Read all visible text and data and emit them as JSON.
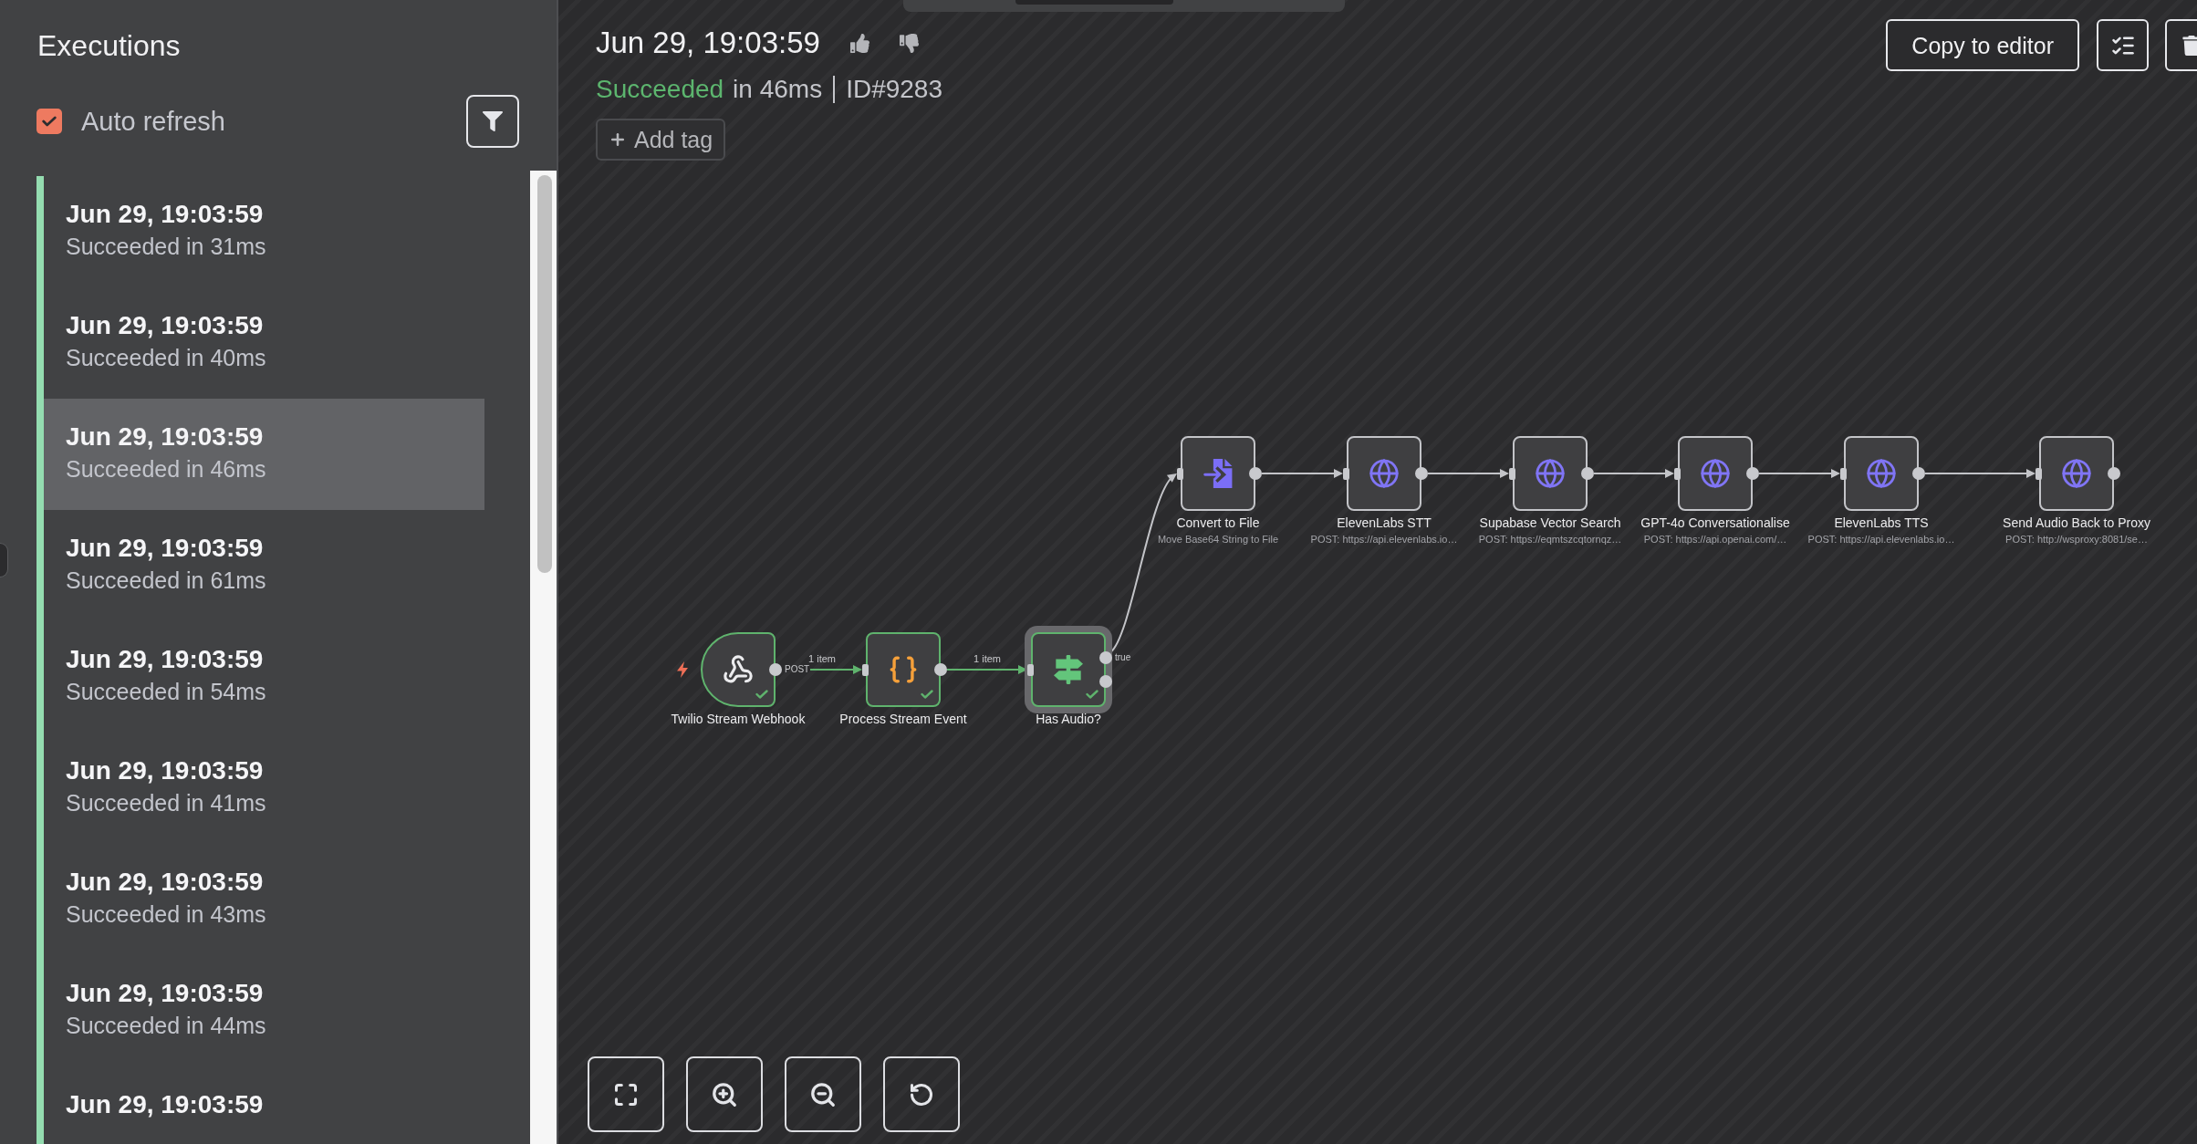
{
  "sidebar": {
    "title": "Executions",
    "auto_refresh": {
      "label": "Auto refresh",
      "checked": true
    },
    "executions": [
      {
        "time": "Jun 29, 19:03:59",
        "status": "Succeeded in 31ms",
        "kind": "success",
        "selected": false
      },
      {
        "time": "Jun 29, 19:03:59",
        "status": "Succeeded in 40ms",
        "kind": "success",
        "selected": false
      },
      {
        "time": "Jun 29, 19:03:59",
        "status": "Succeeded in 46ms",
        "kind": "success",
        "selected": true
      },
      {
        "time": "Jun 29, 19:03:59",
        "status": "Succeeded in 61ms",
        "kind": "success",
        "selected": false
      },
      {
        "time": "Jun 29, 19:03:59",
        "status": "Succeeded in 54ms",
        "kind": "success",
        "selected": false
      },
      {
        "time": "Jun 29, 19:03:59",
        "status": "Succeeded in 41ms",
        "kind": "success",
        "selected": false
      },
      {
        "time": "Jun 29, 19:03:59",
        "status": "Succeeded in 43ms",
        "kind": "success",
        "selected": false
      },
      {
        "time": "Jun 29, 19:03:59",
        "status": "Succeeded in 44ms",
        "kind": "success",
        "selected": false
      },
      {
        "time": "Jun 29, 19:03:59",
        "kind": "success",
        "selected": false
      }
    ]
  },
  "execution": {
    "time": "Jun 29, 19:03:59",
    "status": "Succeeded",
    "kind": "success",
    "duration": "in 46ms",
    "id": "ID#9283",
    "add_tag_button": "Add tag",
    "copy_button": "Copy to editor"
  },
  "workflow": {
    "nodes": [
      {
        "name": "Twilio Stream Webhook",
        "kind": "webhook",
        "trigger": true,
        "executed": true,
        "selected": false,
        "output_label": "POST",
        "edge_label": "1 item"
      },
      {
        "name": "Process Stream Event",
        "kind": "code",
        "trigger": false,
        "executed": true,
        "selected": false,
        "edge_label": "1 item"
      },
      {
        "name": "Has Audio?",
        "kind": "if",
        "trigger": false,
        "executed": true,
        "selected": true,
        "output_label": "true"
      },
      {
        "name": "Convert to File",
        "subtitle": "Move Base64 String to File",
        "kind": "convert",
        "trigger": false,
        "executed": false,
        "selected": false
      },
      {
        "name": "ElevenLabs STT",
        "subtitle": "POST: https://api.elevenlabs.io…",
        "kind": "http",
        "trigger": false,
        "executed": false,
        "selected": false
      },
      {
        "name": "Supabase Vector Search",
        "subtitle": "POST: https://eqmtszcqtornqz…",
        "kind": "http",
        "trigger": false,
        "executed": false,
        "selected": false
      },
      {
        "name": "GPT-4o Conversationalise",
        "subtitle": "POST: https://api.openai.com/…",
        "kind": "http",
        "trigger": false,
        "executed": false,
        "selected": false
      },
      {
        "name": "ElevenLabs TTS",
        "subtitle": "POST: https://api.elevenlabs.io…",
        "kind": "http",
        "trigger": false,
        "executed": false,
        "selected": false
      },
      {
        "name": "Send Audio Back to Proxy",
        "subtitle": "POST: http://wsproxy:8081/se…",
        "kind": "http",
        "trigger": false,
        "executed": false,
        "selected": false
      }
    ]
  }
}
